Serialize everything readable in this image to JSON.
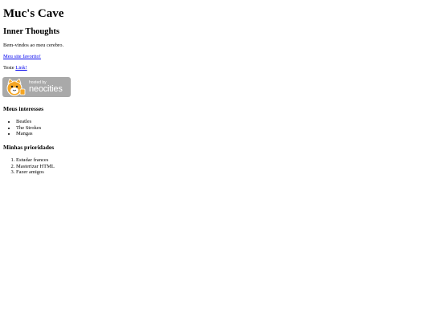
{
  "site": {
    "title": "Muc's Cave"
  },
  "section": {
    "title": "Inner Thoughts"
  },
  "intro": {
    "text": "Bem-vindos ao meu cerebro."
  },
  "favorite": {
    "link_text": "Meu site favorito!"
  },
  "test": {
    "prefix": "Teste ",
    "link_text": "Link!"
  },
  "badge": {
    "small_text": "hosted by",
    "big_text": "neocities",
    "icon": "neocities-cat-icon",
    "color": "#a9a9a9"
  },
  "interests": {
    "title": "Meus interesses",
    "items": [
      "Beatles",
      "The Strokes",
      "Mangas"
    ]
  },
  "priorities": {
    "title": "Minhas prioridades",
    "items": [
      "Estudar frances",
      "Masterizar HTML",
      "Fazer amigos"
    ]
  },
  "colors": {
    "link": "#0000ee",
    "background": "#ffffff",
    "text": "#000000"
  }
}
